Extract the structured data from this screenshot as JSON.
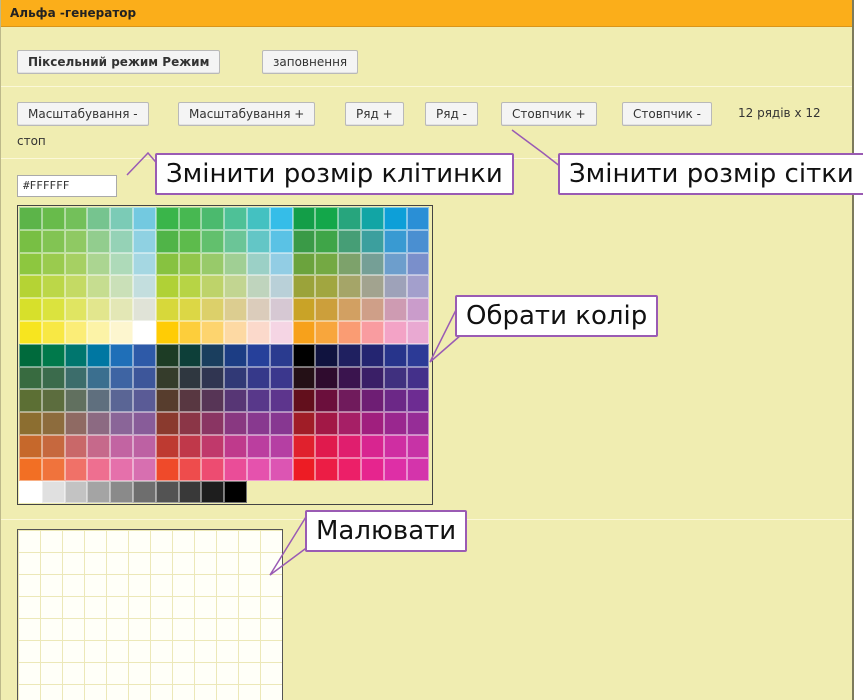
{
  "app": {
    "title": "Альфа -генератор"
  },
  "mode_bar": {
    "pixel_mode_label": "Піксельний режим Режим",
    "fill_label": "заповнення"
  },
  "toolbar": {
    "zoom_out_label": "Масштабування -",
    "zoom_in_label": "Масштабування +",
    "row_add_label": "Ряд +",
    "row_remove_label": "Ряд -",
    "col_add_label": "Стовпчик +",
    "col_remove_label": "Стовпчик -",
    "grid_info_line1": "12 рядів x 12",
    "grid_info_line2": "стоп"
  },
  "color_input": {
    "value": "#FFFFFF"
  },
  "palette": {
    "rows": [
      [
        "#5cb449",
        "#68bb4b",
        "#73c05a",
        "#76c48f",
        "#7bcbb6",
        "#73c9e0",
        "#3ab54a",
        "#47b851",
        "#4bba6e",
        "#4ec197",
        "#44c1c1",
        "#35bde8",
        "#139e48",
        "#13a74a",
        "#27a57d",
        "#12a5a5",
        "#0d9fd8",
        "#2a8fd6"
      ],
      [
        "#78bf44",
        "#82c453",
        "#8fc963",
        "#92cd8e",
        "#95d2b6",
        "#8fd1e2",
        "#50b448",
        "#5dbb4c",
        "#62c06d",
        "#6bc597",
        "#63c6c6",
        "#5ac2e5",
        "#3a9a47",
        "#3fa548",
        "#469e76",
        "#3c9f9e",
        "#399ad2",
        "#4a8fd1"
      ],
      [
        "#8dc73f",
        "#9acb4e",
        "#a6d063",
        "#abd591",
        "#aedab9",
        "#a5d7e2",
        "#87c240",
        "#91c64a",
        "#98ca6a",
        "#a0cf94",
        "#9bd0c6",
        "#92cde4",
        "#6ba33d",
        "#74a943",
        "#7da26b",
        "#759f96",
        "#6d9ecc",
        "#7a8fcb"
      ],
      [
        "#b5d334",
        "#bcd748",
        "#c4da64",
        "#c6dd90",
        "#cae0b8",
        "#c3dede",
        "#b0d136",
        "#b7d445",
        "#bed36a",
        "#c2d591",
        "#bfd4bd",
        "#b9d0d8",
        "#9ba33a",
        "#a1a640",
        "#a5a568",
        "#a2a38f",
        "#9ea2b9",
        "#a39fcc"
      ],
      [
        "#d7e02b",
        "#dbe33e",
        "#e0e562",
        "#e2e68d",
        "#e3e7b5",
        "#e0e3d7",
        "#d7d83a",
        "#dcd745",
        "#dcd06a",
        "#dccd90",
        "#dbccbb",
        "#d6c8d3",
        "#c9a327",
        "#cc9f3b",
        "#d2a062",
        "#cf9f88",
        "#ce9bb2",
        "#ca9ccb"
      ],
      [
        "#f7e51f",
        "#f8e844",
        "#fbed77",
        "#fcf3a7",
        "#fdf6cf",
        "#ffffff",
        "#ffcc05",
        "#fdce3b",
        "#fdd46e",
        "#fdd9a3",
        "#fbd9cb",
        "#f5d5e4",
        "#f7a11b",
        "#f8a63c",
        "#fa9c73",
        "#f99ca0",
        "#f3a3c6",
        "#e9a9d2"
      ],
      [
        "#006a3c",
        "#00794b",
        "#00766e",
        "#0077a2",
        "#1f6fb8",
        "#2e5aa8",
        "#1d3c25",
        "#0d3f39",
        "#1a3e5e",
        "#1c3d84",
        "#26409a",
        "#2a3b8f",
        "#000000",
        "#10133f",
        "#1f2060",
        "#242571",
        "#27348b",
        "#2c3a96"
      ],
      [
        "#386b40",
        "#3b6b4c",
        "#3c6d6b",
        "#3b6f8f",
        "#3e64a3",
        "#3d569a",
        "#353c2b",
        "#2f3740",
        "#303551",
        "#313976",
        "#36398a",
        "#3b378d",
        "#241016",
        "#2f0b2e",
        "#3a144e",
        "#3a1f67",
        "#40307f",
        "#44308a"
      ],
      [
        "#5c6f34",
        "#5c6d3e",
        "#61705f",
        "#5f6f7e",
        "#5a6595",
        "#5a5b96",
        "#573d2d",
        "#583741",
        "#573556",
        "#573675",
        "#58388a",
        "#5d358d",
        "#620f1c",
        "#6b0f3c",
        "#701b5c",
        "#6e1e74",
        "#6c2887",
        "#6d2c92"
      ],
      [
        "#8c6e30",
        "#8d6c3d",
        "#8f6a63",
        "#8c6a82",
        "#8a6598",
        "#885c99",
        "#8a3a2e",
        "#8b3647",
        "#8a3563",
        "#893881",
        "#88398f",
        "#873791",
        "#a01d27",
        "#a21846",
        "#a61f66",
        "#a01f7e",
        "#9a278f",
        "#962d97"
      ],
      [
        "#c6682b",
        "#c6683e",
        "#c96869",
        "#c6698b",
        "#c264a2",
        "#bd61a3",
        "#be3a31",
        "#c0384a",
        "#c0396b",
        "#bf3a8c",
        "#bb3e9f",
        "#b53fa3",
        "#e0212d",
        "#e01a4d",
        "#e01e6e",
        "#d82590",
        "#cf2ea2",
        "#c733a6"
      ],
      [
        "#f26f24",
        "#f0733c",
        "#f07168",
        "#ee6f90",
        "#e570ab",
        "#d76fb0",
        "#ef4a2a",
        "#ee4c4c",
        "#ed4c71",
        "#ea4d98",
        "#e552ad",
        "#dc55b3",
        "#ed1c24",
        "#ec1d45",
        "#ec1f68",
        "#e6258e",
        "#de2fa6",
        "#d434ab"
      ],
      [
        "#ffffff",
        "#e0e0e0",
        "#c3c3c3",
        "#a4a4a4",
        "#8a8a8a",
        "#6e6e6e",
        "#535353",
        "#393939",
        "#1e1e1e",
        "#000000"
      ]
    ]
  },
  "callouts": {
    "cell_size": "Змінити розмір клітинки",
    "grid_size": "Змінити розмір сітки",
    "pick_color": "Обрати колір",
    "draw": "Малювати"
  },
  "colors": {
    "titlebar": "#fbae1a",
    "background": "#f0edb1",
    "callout_border": "#9a5bb4"
  }
}
